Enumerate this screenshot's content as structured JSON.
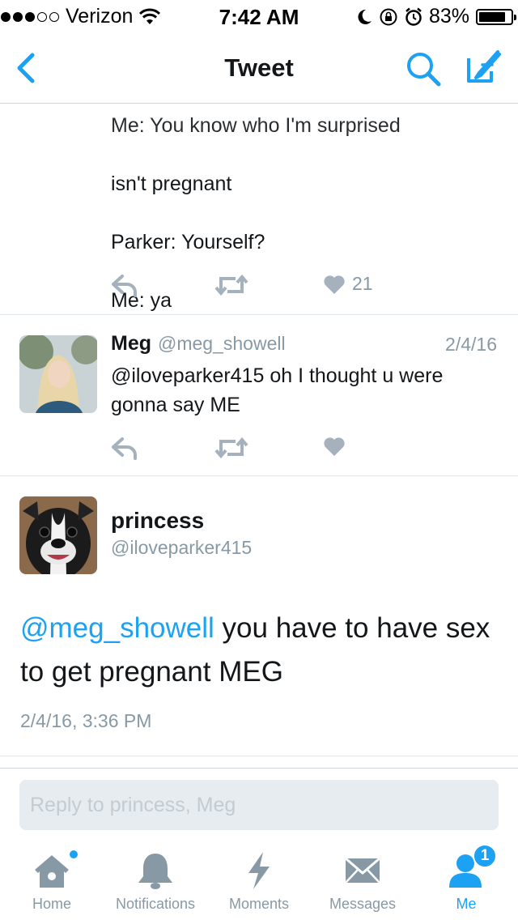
{
  "status_bar": {
    "carrier": "Verizon",
    "time": "7:42 AM",
    "battery": "83%",
    "battery_level": 0.83,
    "signal_bars_filled": 3,
    "signal_bars_total": 5,
    "icons": [
      "wifi-icon",
      "moon-icon",
      "rotation-lock-icon",
      "alarm-icon",
      "battery-icon"
    ]
  },
  "nav": {
    "title": "Tweet",
    "icons": [
      "back-chevron-icon",
      "search-icon",
      "compose-icon"
    ],
    "accent_color": "#1da1f2"
  },
  "tweets": [
    {
      "text": "isn't pregnant\n\nParker: Yourself?\n\nMe: ya",
      "like_count": "21",
      "icons": [
        "reply-icon",
        "retweet-icon",
        "heart-icon"
      ]
    },
    {
      "name": "Meg",
      "handle": "@meg_showell",
      "date": "2/4/16",
      "text": "@iloveparker415 oh I thought u were gonna say ME",
      "icons": [
        "reply-icon",
        "retweet-icon",
        "heart-icon"
      ]
    }
  ],
  "main_tweet": {
    "name": "princess",
    "handle": "@iloveparker415",
    "mention": "@meg_showell",
    "text": " you have to have sex to get pregnant MEG",
    "timestamp": "2/4/16, 3:36 PM"
  },
  "reply": {
    "placeholder": "Reply to princess, Meg"
  },
  "tab_bar": {
    "tabs": [
      {
        "label": "Home",
        "icon": "home-icon",
        "has_dot": true
      },
      {
        "label": "Notifications",
        "icon": "bell-icon"
      },
      {
        "label": "Moments",
        "icon": "lightning-icon"
      },
      {
        "label": "Messages",
        "icon": "envelope-icon"
      },
      {
        "label": "Me",
        "icon": "person-icon",
        "active": true,
        "badge": "1"
      }
    ]
  },
  "colors": {
    "accent": "#1da1f2",
    "secondary_text": "#8899a6",
    "icon_gray": "#a5b2bd"
  }
}
